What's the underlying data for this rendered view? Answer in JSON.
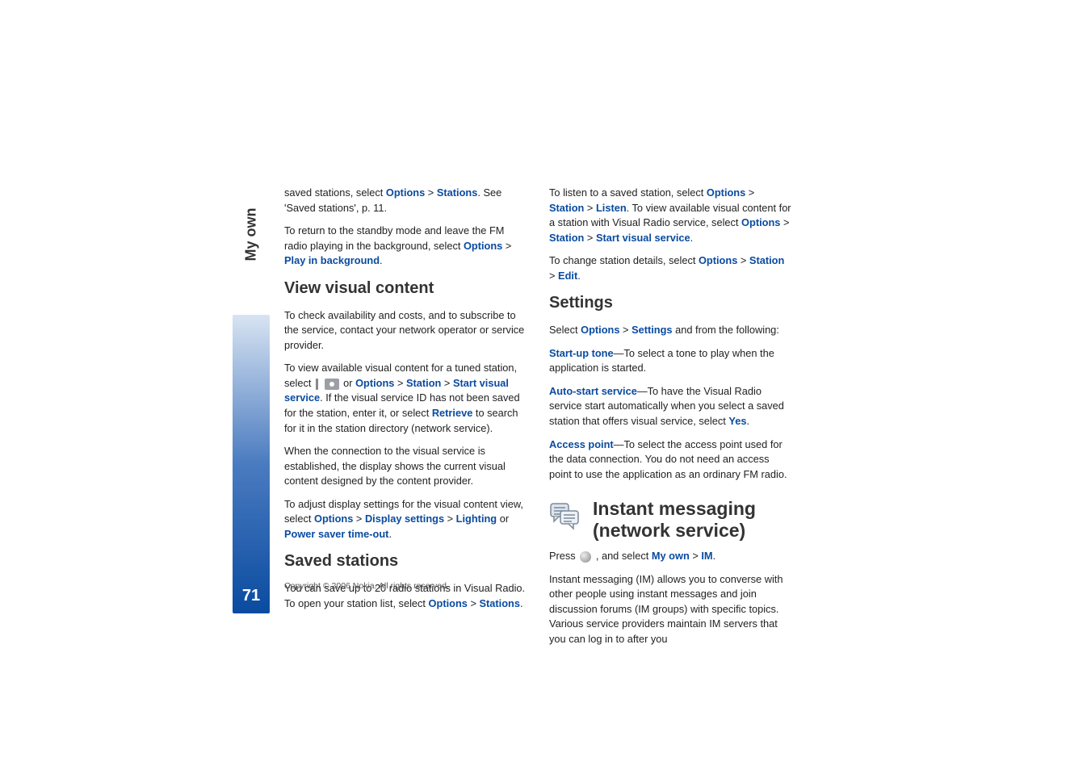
{
  "sidebar": {
    "section_label": "My own",
    "page_number": "71"
  },
  "left": {
    "p1a": "saved stations, select ",
    "p1_opt": "Options",
    "p1_gt": " > ",
    "p1_stn": "Stations",
    "p1b": ". See 'Saved stations', p. 11.",
    "p2a": "To return to the standby mode and leave the FM radio playing in the background, select ",
    "p2_opt": "Options",
    "p2_gt": " > ",
    "p2_play": "Play in background",
    "p2b": ".",
    "h3a": "View visual content",
    "p3": "To check availability and costs, and to subscribe to the service, contact your network operator or service provider.",
    "p4a": "To view available visual content for a tuned station, select ",
    "p4_or": " or ",
    "p4_opt": "Options",
    "p4_gt": " > ",
    "p4_stn": "Station",
    "p4_svs": "Start visual service",
    "p4b": ". If the visual service ID has not been saved for the station, enter it, or select ",
    "p4_ret": "Retrieve",
    "p4c": " to search for it in the station directory (network service).",
    "p5": "When the connection to the visual service is established, the display shows the current visual content designed by the content provider.",
    "p6a": "To adjust display settings for the visual content view, select ",
    "p6_opt": "Options",
    "p6_gt": " > ",
    "p6_ds": "Display settings",
    "p6_lt": "Lighting",
    "p6_or": " or ",
    "p6_ps": "Power saver time-out",
    "p6b": ".",
    "h3b": "Saved stations",
    "p7a": "You can save up to 20 radio stations in Visual Radio. To open your station list, select ",
    "p7_opt": "Options",
    "p7_gt": " > ",
    "p7_stn": "Stations",
    "p7b": "."
  },
  "right": {
    "p1a": "To listen to a saved station, select ",
    "p1_opt": "Options",
    "p1_gt": " > ",
    "p1_stn": "Station",
    "p1_lst": "Listen",
    "p1b": ". To view available visual content for a station with Visual Radio service, select ",
    "p1_opt2": "Options",
    "p1_stn2": "Station",
    "p1_svs": "Start visual service",
    "p1c": ".",
    "p2a": "To change station details, select ",
    "p2_opt": "Options",
    "p2_gt": " > ",
    "p2_stn": "Station",
    "p2_edt": "Edit",
    "p2b": ".",
    "h3c": "Settings",
    "p3a": "Select ",
    "p3_opt": "Options",
    "p3_gt": " > ",
    "p3_set": "Settings",
    "p3b": " and from the following:",
    "p4_su": "Start-up tone",
    "p4a": "—To select a tone to play when the application is started.",
    "p5_as": "Auto-start service",
    "p5a": "—To have the Visual Radio service start automatically when you select a saved station that offers visual service, select ",
    "p5_yes": "Yes",
    "p5b": ".",
    "p6_ap": "Access point",
    "p6a": "—To select the access point used for the data connection. You do not need an access point to use the application as an ordinary FM radio.",
    "h2": "Instant messaging (network service)",
    "p7a": "Press ",
    "p7b": " , and select ",
    "p7_mo": "My own",
    "p7_gt": " > ",
    "p7_im": "IM",
    "p7c": ".",
    "p8": "Instant messaging (IM) allows you to converse with other people using instant messages and join discussion forums (IM groups) with specific topics. Various service providers maintain IM servers that you can log in to after you"
  },
  "footer": {
    "copyright": "Copyright © 2006 Nokia. All rights reserved."
  }
}
